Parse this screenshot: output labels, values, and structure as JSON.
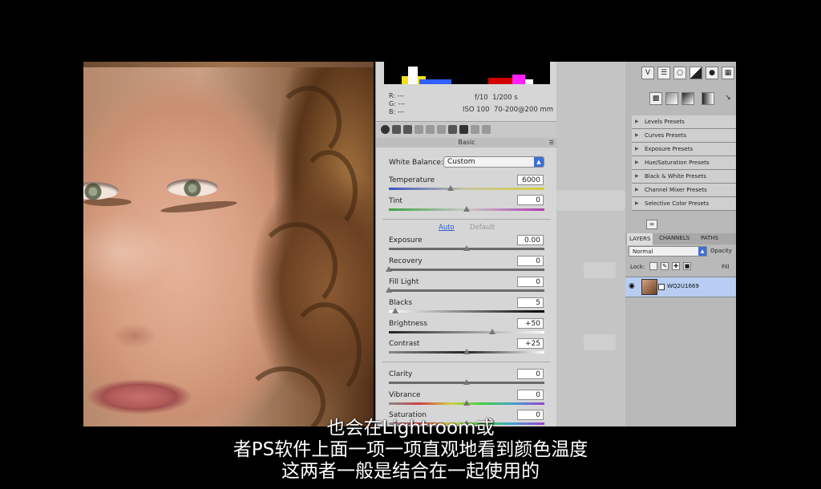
{
  "camera_raw": {
    "rgb_labels": [
      "R:",
      "G:",
      "B:"
    ],
    "rgb_values": [
      "---",
      "---",
      "---"
    ],
    "aperture": "f/10",
    "shutter": "1/200 s",
    "iso": "ISO 100",
    "lens": "70-200@200 mm",
    "section_title": "Basic",
    "white_balance_label": "White Balance:",
    "white_balance_value": "Custom",
    "auto_link": "Auto",
    "default_link": "Default",
    "sliders": {
      "temperature": {
        "label": "Temperature",
        "value": "6000"
      },
      "tint": {
        "label": "Tint",
        "value": "0"
      },
      "exposure": {
        "label": "Exposure",
        "value": "0.00"
      },
      "recovery": {
        "label": "Recovery",
        "value": "0"
      },
      "fill_light": {
        "label": "Fill Light",
        "value": "0"
      },
      "blacks": {
        "label": "Blacks",
        "value": "5"
      },
      "brightness": {
        "label": "Brightness",
        "value": "+50"
      },
      "contrast": {
        "label": "Contrast",
        "value": "+25"
      },
      "clarity": {
        "label": "Clarity",
        "value": "0"
      },
      "vibrance": {
        "label": "Vibrance",
        "value": "0"
      },
      "saturation": {
        "label": "Saturation",
        "value": "0"
      }
    }
  },
  "photoshop": {
    "presets": [
      "Levels Presets",
      "Curves Presets",
      "Exposure Presets",
      "Hue/Saturation Presets",
      "Black & White Presets",
      "Channel Mixer Presets",
      "Selective Color Presets"
    ],
    "layer_tabs": [
      "LAYERS",
      "CHANNELS",
      "PATHS"
    ],
    "blend_mode": "Normal",
    "opacity_label": "Opacity",
    "lock_label": "Lock:",
    "fill_label": "Fill",
    "layer_name": "WQ2U1669"
  },
  "subtitles": {
    "line1": "也会在Lightroom或",
    "line2": "者PS软件上面一项一项直观地看到颜色温度",
    "line3": "这两者一般是结合在一起使用的"
  }
}
